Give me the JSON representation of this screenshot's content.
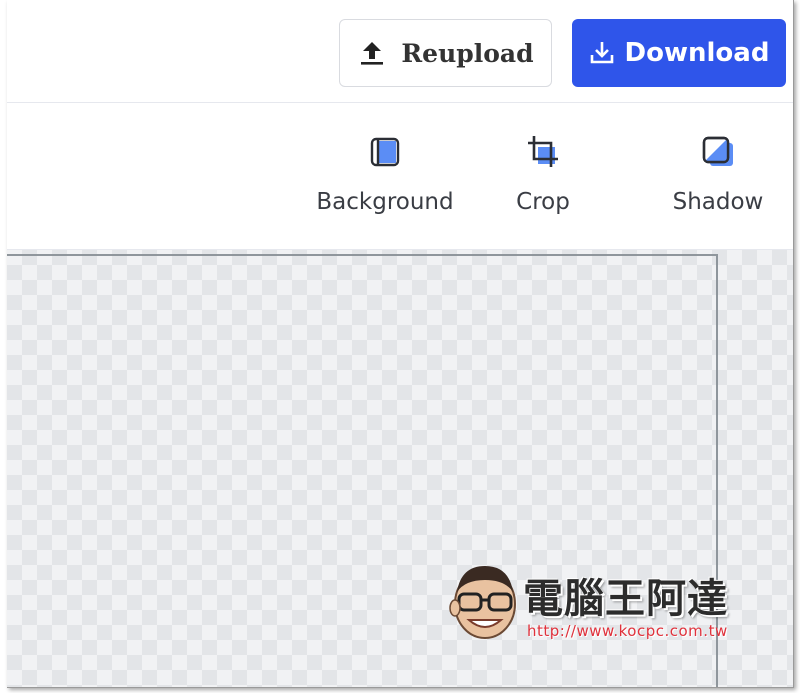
{
  "colors": {
    "accent": "#2f55ea",
    "tool_highlight": "#5b8df5",
    "watermark_url": "#e0323c"
  },
  "toolbar": {
    "reupload_label": "Reupload",
    "reupload_icon": "upload-icon",
    "download_label": "Download",
    "download_icon": "download-icon"
  },
  "tools": [
    {
      "label": "Background",
      "icon": "background-icon"
    },
    {
      "label": "Crop",
      "icon": "crop-icon"
    },
    {
      "label": "Shadow",
      "icon": "shadow-icon"
    }
  ],
  "watermark": {
    "title": "電腦王阿達",
    "url": "http://www.kocpc.com.tw"
  }
}
